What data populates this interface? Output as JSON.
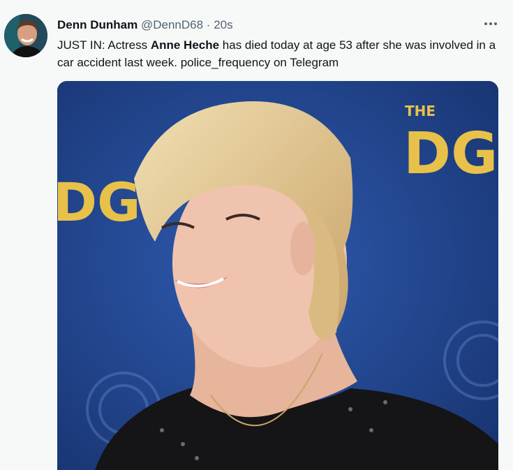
{
  "tweet": {
    "author_name": "Denn Dunham",
    "handle": "@DennD68",
    "separator": "·",
    "timestamp": "20s",
    "more_icon": "more-horizontal-icon",
    "text_before": "JUST IN: Actress ",
    "text_bold": "Anne Heche",
    "text_after": " has died today at age 53 after she was involved in a car accident last week. police_frequency on Telegram",
    "media": {
      "backdrop_wordmark": "DG",
      "backdrop_top_word": "THE"
    }
  },
  "colors": {
    "backdrop_blue": "#1f3f86",
    "logo_gold": "#e8c14a",
    "text_primary": "#0f1419",
    "text_secondary": "#536471"
  }
}
